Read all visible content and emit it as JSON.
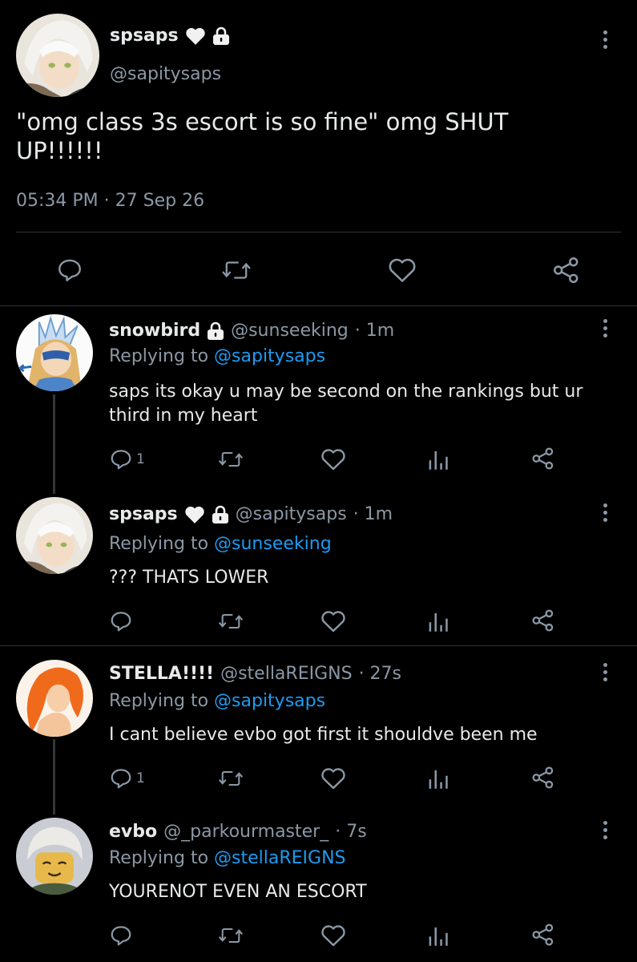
{
  "main_tweet": {
    "display_name": "spsaps",
    "handle": "@sapitysaps",
    "text": "\"omg class 3s escort is so fine\" omg SHUT UP!!!!!!",
    "timestamp": "05:34 PM · 27 Sep 26",
    "actions": [
      "reply-icon",
      "retweet-icon",
      "like-icon",
      "share-icon"
    ]
  },
  "replies": [
    {
      "display_name": "snowbird",
      "handle": "@sunseeking",
      "time": "· 1m",
      "replying_label": "Replying to",
      "replying_to": "@sapitysaps",
      "text": "saps its okay u may be second on the rankings but ur third in my heart",
      "reply_count": "1"
    },
    {
      "display_name": "spsaps",
      "handle": "@sapitysaps",
      "time": "· 1m",
      "replying_label": "Replying to",
      "replying_to": "@sunseeking",
      "text": "??? THATS LOWER",
      "reply_count": ""
    },
    {
      "display_name": "STELLA!!!!",
      "handle": "@stellaREIGNS",
      "time": "· 27s",
      "replying_label": "Replying to",
      "replying_to": "@sapitysaps",
      "text": "I cant believe evbo got first it shouldve been me",
      "reply_count": "1"
    },
    {
      "display_name": "evbo",
      "handle": "@_parkourmaster_",
      "time": "· 7s",
      "replying_label": "Replying to",
      "replying_to": "@stellaREIGNS",
      "text": "YOURENOT EVEN AN ESCORT",
      "reply_count": ""
    }
  ],
  "colors": {
    "background": "#000000",
    "text": "#e7e9ea",
    "secondary": "#8b98a5",
    "link": "#1d9bf0",
    "divider": "#2f3336"
  }
}
